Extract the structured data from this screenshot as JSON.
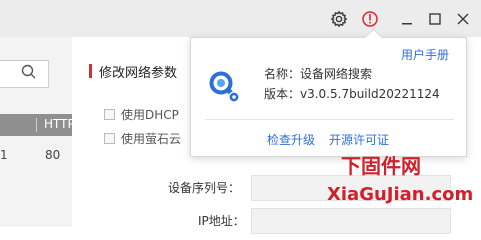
{
  "toolbar": {
    "icons": [
      "gear-icon",
      "info-icon",
      "minimize-icon",
      "maximize-icon",
      "close-icon"
    ],
    "accent": "#e0262e"
  },
  "left_panel": {
    "search_placeholder": "",
    "table": {
      "columns": [
        "",
        "HTTP"
      ],
      "row": [
        "1",
        "80"
      ]
    }
  },
  "config": {
    "section_title": "修改网络参数",
    "options": [
      {
        "label": "使用DHCP",
        "checked": false
      },
      {
        "label": "使用萤石云",
        "checked": false
      }
    ],
    "fields": [
      {
        "label": "设备序列号：",
        "value": ""
      },
      {
        "label": "IP地址：",
        "value": ""
      }
    ]
  },
  "about_popup": {
    "manual_link": "用户手册",
    "name_line": "名称：设备网络搜索",
    "version_line": "版本：v3.0.5.7build20221124",
    "check_update": "检查升级",
    "license_link": "开源许可证"
  },
  "watermark": {
    "cn": "下固件网",
    "en": "XiaGuJian.com"
  }
}
